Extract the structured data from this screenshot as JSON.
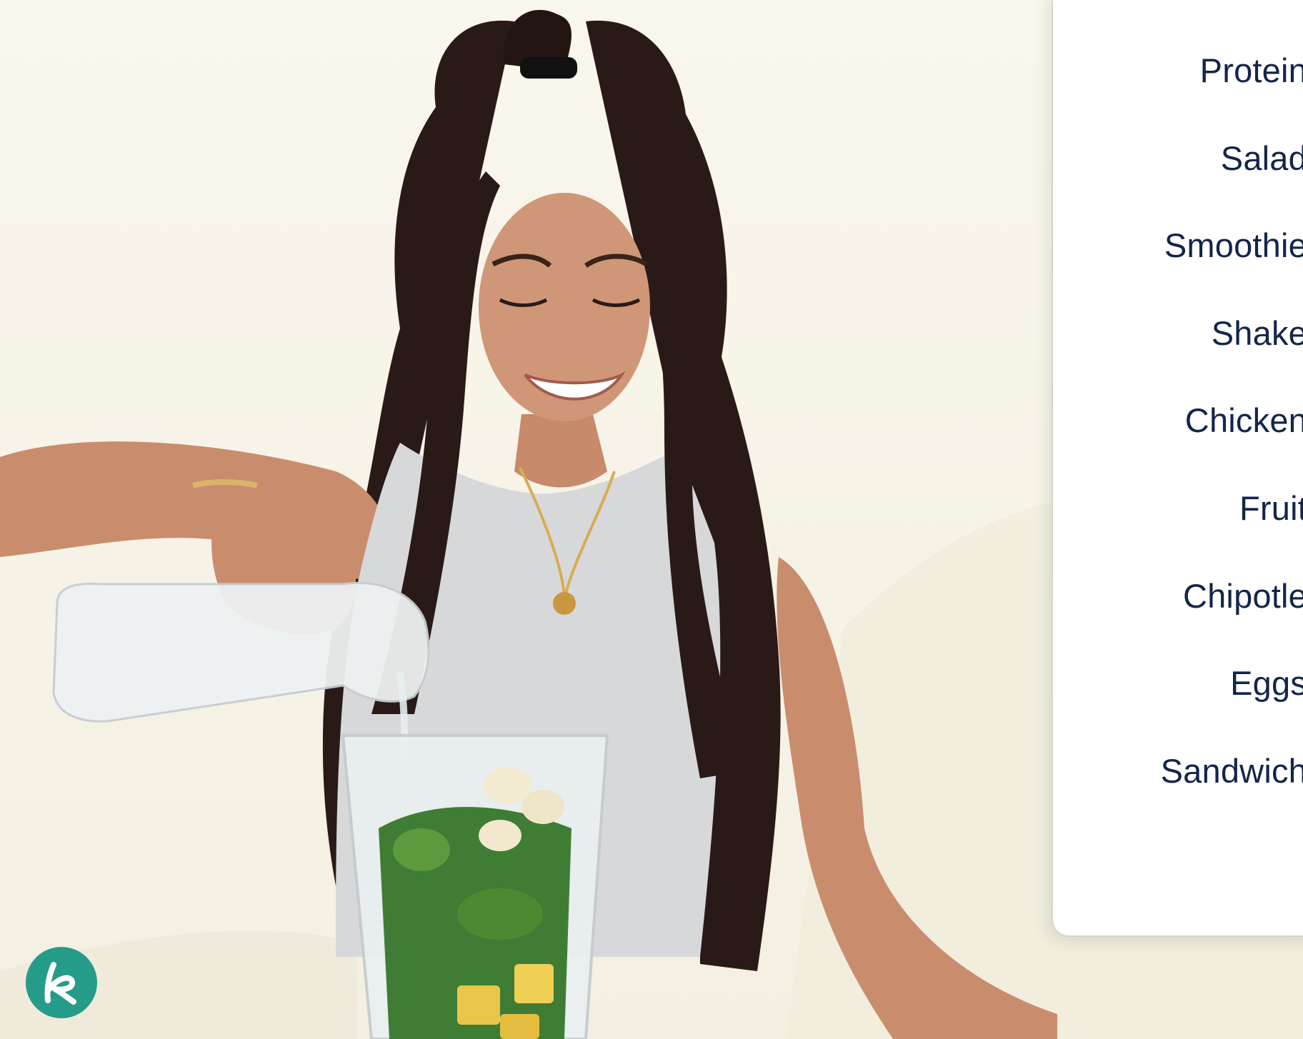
{
  "page": {
    "background_color": "#f7f4ea"
  },
  "menu": {
    "text_color": "#13254a",
    "items": [
      {
        "label": "Protein"
      },
      {
        "label": "Salad"
      },
      {
        "label": "Smoothie"
      },
      {
        "label": "Shake"
      },
      {
        "label": "Chicken"
      },
      {
        "label": "Fruit"
      },
      {
        "label": "Chipotle"
      },
      {
        "label": "Eggs"
      },
      {
        "label": "Sandwich"
      }
    ]
  },
  "brand": {
    "logo_icon": "k-logo-icon",
    "logo_color": "#259c89"
  },
  "hero": {
    "icon": "woman-pouring-water-into-blender-photo"
  }
}
